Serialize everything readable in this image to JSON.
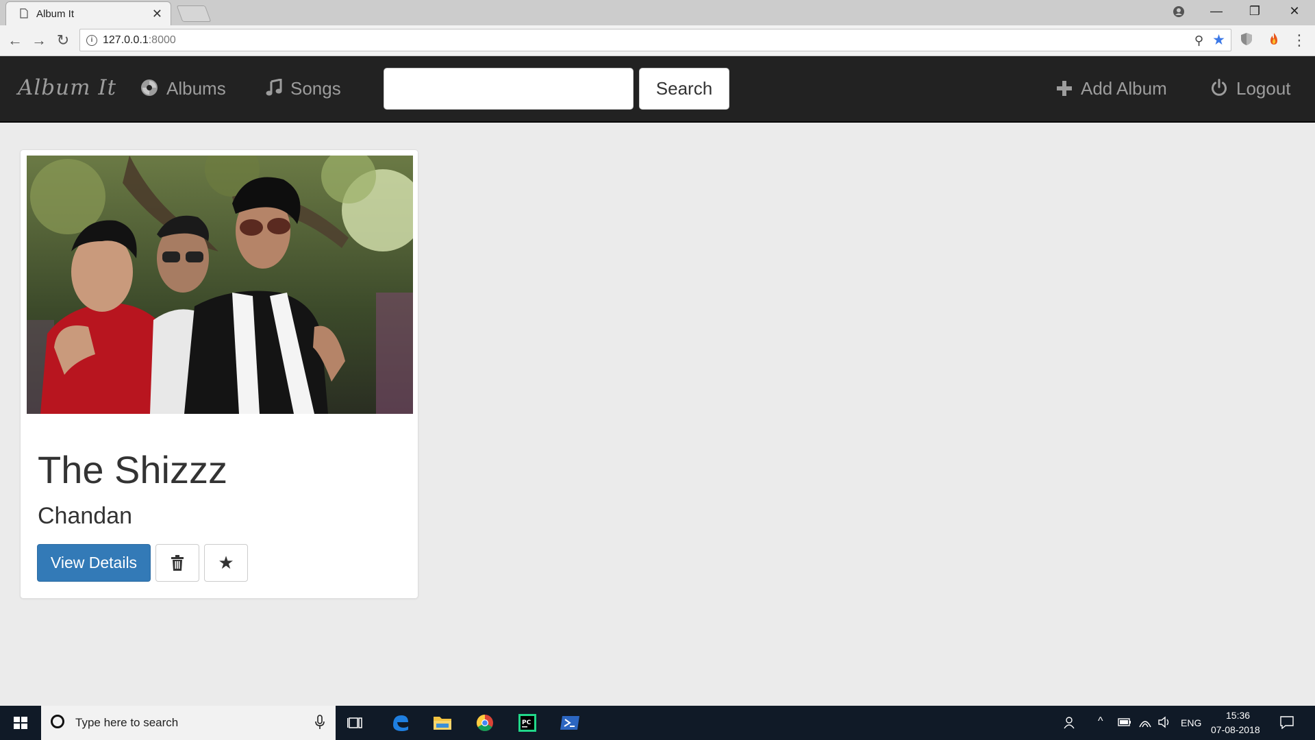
{
  "browser": {
    "tab_title": "Album It",
    "tab_close": "✕",
    "url_host": "127.0.0.1",
    "url_port": ":8000",
    "window_controls": {
      "minimize": "—",
      "restore": "❐",
      "close": "✕"
    }
  },
  "navbar": {
    "brand": "Album It",
    "links": [
      {
        "label": "Albums",
        "icon": "disc-icon"
      },
      {
        "label": "Songs",
        "icon": "music-note-icon"
      }
    ],
    "search_button": "Search",
    "search_value": "",
    "right_links": [
      {
        "label": "Add Album",
        "icon": "plus-icon"
      },
      {
        "label": "Logout",
        "icon": "power-icon"
      }
    ],
    "colors": {
      "background": "#222222",
      "link": "#9d9d9d"
    }
  },
  "albums": [
    {
      "title": "The Shizzz",
      "artist": "Chandan",
      "details_button": "View Details",
      "delete_icon": "trash-icon",
      "favorite_icon": "star-icon",
      "favorite_glyph": "★"
    }
  ],
  "colors": {
    "primary": "#337ab7"
  },
  "taskbar": {
    "search_placeholder": "Type here to search",
    "language": "ENG",
    "time": "15:36",
    "date": "07-08-2018"
  }
}
